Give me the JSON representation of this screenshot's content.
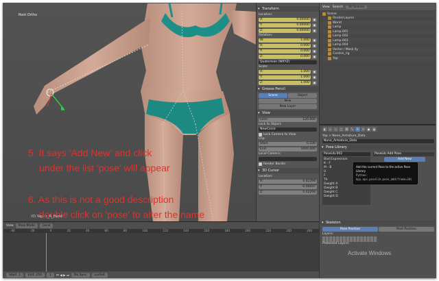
{
  "viewport": {
    "title": "Root Ortho",
    "status": "(0) Yap : r_R_Hand"
  },
  "annotations": {
    "step5_line1": "5. It says 'Add New' and click",
    "step5_line2": "under the list 'pose' will appear",
    "step6_line1": "6. As this is not a good description",
    "step6_line2": "double click on 'pose' to alter the name"
  },
  "npanel": {
    "transform_header": "Transform",
    "location_label": "Location:",
    "location": [
      {
        "axis": "X:",
        "value": "0.00000"
      },
      {
        "axis": "Y:",
        "value": "0.00000"
      },
      {
        "axis": "Z:",
        "value": "0.00000"
      }
    ],
    "rotation_label": "Rotation:",
    "rotation": [
      {
        "axis": "W:",
        "value": "1.000"
      },
      {
        "axis": "X:",
        "value": "0.000"
      },
      {
        "axis": "Y:",
        "value": "0.000"
      },
      {
        "axis": "Z:",
        "value": "0.000"
      }
    ],
    "rotation_mode": "Quaternion (WXYZ)",
    "scale_label": "Scale:",
    "scale": [
      {
        "axis": "X:",
        "value": "1.000"
      },
      {
        "axis": "Y:",
        "value": "1.000"
      },
      {
        "axis": "Z:",
        "value": "1.000"
      }
    ],
    "grease_header": "Grease Pencil",
    "scene_btn": "Scene",
    "object_btn": "Object",
    "new_btn": "New",
    "new_layer_btn": "New Layer",
    "view_header": "View",
    "lens_label": "Lens:",
    "lens_value": "120.000",
    "lock_obj_label": "Lock to Object:",
    "lock_obj_value": "NewCorce",
    "lock_cam_label": "Lock Camera to View",
    "clip_label": "Clip:",
    "clip_start_label": "Start:",
    "clip_start": "0.100",
    "clip_end_label": "End:",
    "clip_end": "1000.000",
    "local_cam_label": "Local Camera:",
    "render_border": "Render Border",
    "cursor_header": "3D Cursor",
    "cursor_loc_label": "Location:",
    "cursor": [
      {
        "axis": "X:",
        "value": "0.42294"
      },
      {
        "axis": "Y:",
        "value": "-0.06697"
      },
      {
        "axis": "Z:",
        "value": "0.42294"
      }
    ]
  },
  "outliner": {
    "view": "View",
    "search": "Search",
    "scenes": "All Scenes",
    "rows": [
      "Scene",
      "RenderLayers",
      "World",
      "Lamp",
      "Lamp.001",
      "Lamp.002",
      "Lamp.003",
      "Lamp.004",
      "Vector / Mask ily",
      "Control_rig",
      "Yap"
    ]
  },
  "properties": {
    "breadcrumb": "Yap > None_Armature_Data",
    "data_name": "None_Armature_Data",
    "pose_library_header": "Pose Library",
    "pose_lib_name": "PoseLib.002",
    "tooltip_title": "PoseLib Add Pose",
    "add_new": "Add New",
    "tooltip_desc": "Add the current Pose to the active Pose Library",
    "tooltip_python": "Python: bpy.ops.poselib.pose_add(frame=10)",
    "list_items": [
      "Bad Expression",
      "K - F",
      "M - B",
      "U",
      "F",
      "Th",
      "Dwight A",
      "Dwight B",
      "Dwight C",
      "Dwight D"
    ],
    "skeleton_header": "Skeleton",
    "pose_position": "Pose Position",
    "rest_position": "Rest Position",
    "layers_label": "Layers:",
    "protected_layers": "Protected Layers:"
  },
  "timeline": {
    "view": "View",
    "mode": "Pose Mode",
    "pivot": "Local",
    "ruler": [
      "-40",
      "-20",
      "0",
      "20",
      "40",
      "60",
      "80",
      "100",
      "120",
      "140",
      "160",
      "180",
      "200",
      "220",
      "240",
      "260"
    ],
    "start_label": "Start:",
    "start": "1",
    "end_label": "End:",
    "end": "250",
    "frame": "1",
    "sync": "No Sync",
    "keying": "LocRot"
  },
  "watermark": "Activate Windows"
}
